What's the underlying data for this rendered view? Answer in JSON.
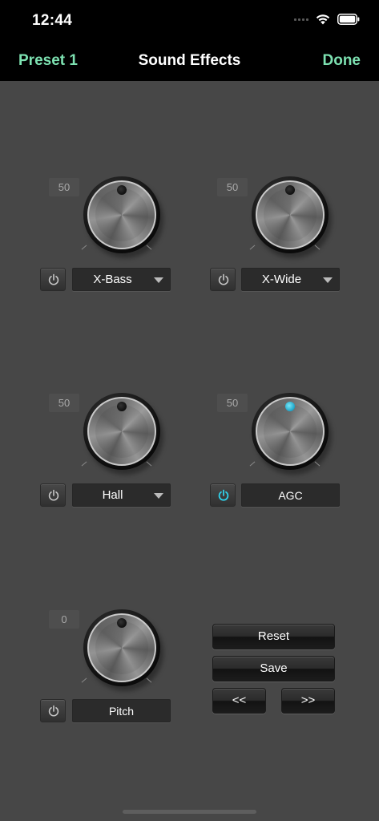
{
  "status_bar": {
    "time": "12:44"
  },
  "nav": {
    "left": "Preset 1",
    "title": "Sound Effects",
    "right": "Done"
  },
  "effects": [
    {
      "value": "50",
      "label": "X-Bass",
      "power_on": false,
      "has_dropdown": true,
      "knob_icon": "knob-icon"
    },
    {
      "value": "50",
      "label": "X-Wide",
      "power_on": false,
      "has_dropdown": true,
      "knob_icon": "knob-icon"
    },
    {
      "value": "50",
      "label": "Hall",
      "power_on": false,
      "has_dropdown": true,
      "knob_icon": "knob-icon"
    },
    {
      "value": "50",
      "label": "AGC",
      "power_on": true,
      "has_dropdown": false,
      "knob_icon": "knob-icon"
    },
    {
      "value": "0",
      "label": "Pitch",
      "power_on": false,
      "has_dropdown": false,
      "knob_icon": "knob-icon"
    }
  ],
  "buttons": {
    "reset": "Reset",
    "save": "Save",
    "prev": "<<",
    "next": ">>"
  },
  "colors": {
    "accent": "#7de1b1",
    "power_on": "#2fd0e8",
    "background": "#474747"
  }
}
